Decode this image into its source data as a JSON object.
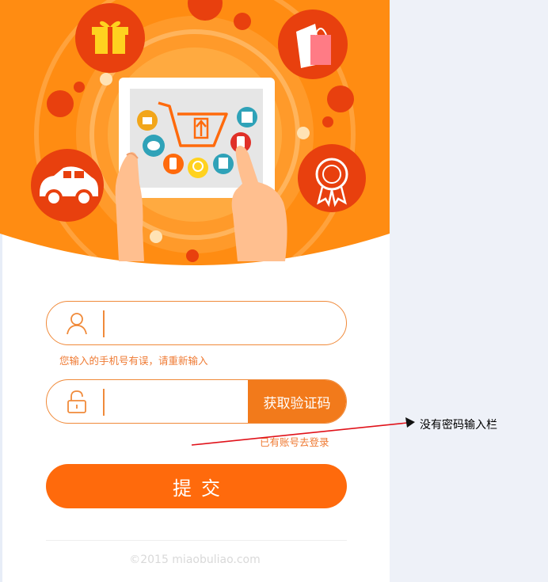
{
  "form": {
    "phone_placeholder": "",
    "phone_error": "您输入的手机号有误，请重新输入",
    "code_placeholder": "",
    "get_code_label": "获取验证码",
    "login_link": "已有账号去登录",
    "submit_label": "提交"
  },
  "footer": {
    "copyright": "©2015 miaobuliao.com"
  },
  "annotation": {
    "text": "没有密码输入栏"
  },
  "colors": {
    "brand_orange": "#ff6a0c",
    "hero_orange": "#ff8c12",
    "accent_red": "#e8400e",
    "page_bg": "#eef1f8"
  },
  "icons": [
    "gift-icon",
    "shopping-bag-icon",
    "car-icon",
    "award-ribbon-icon",
    "cart-upload-icon",
    "user-icon",
    "lock-icon"
  ]
}
